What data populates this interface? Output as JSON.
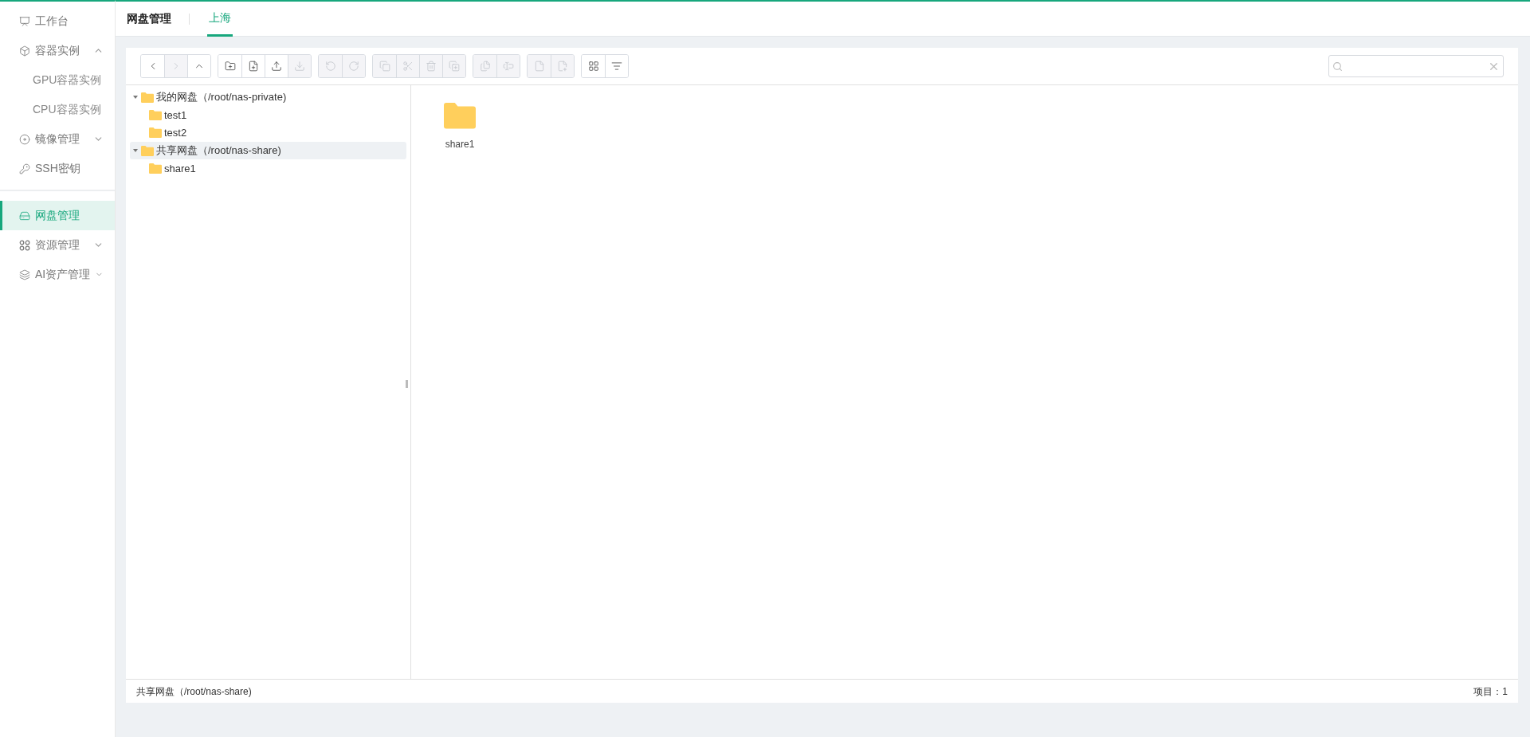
{
  "sidebar": {
    "sections": [
      {
        "items": [
          {
            "label": "工作台",
            "selected": false
          },
          {
            "label": "容器实例",
            "selected": false,
            "expanded": true,
            "children": [
              {
                "label": "GPU容器实例",
                "selected": false
              },
              {
                "label": "CPU容器实例",
                "selected": false
              }
            ]
          },
          {
            "label": "镜像管理",
            "selected": false,
            "expanded": false
          },
          {
            "label": "SSH密钥",
            "selected": false
          }
        ]
      },
      {
        "items": [
          {
            "label": "网盘管理",
            "selected": true
          },
          {
            "label": "资源管理",
            "selected": false,
            "expanded": false
          },
          {
            "label": "AI资产管理",
            "selected": false,
            "expanded": false
          }
        ]
      }
    ]
  },
  "header": {
    "title": "网盘管理",
    "tabs": [
      {
        "label": "上海",
        "selected": true
      }
    ]
  },
  "toolbar": {
    "groups": [
      [
        {
          "disabled": false
        },
        {
          "disabled": true
        },
        {
          "disabled": false
        }
      ],
      [
        {
          "disabled": false
        },
        {
          "disabled": false
        },
        {
          "disabled": false
        },
        {
          "disabled": true
        }
      ],
      [
        {
          "disabled": true
        },
        {
          "disabled": true
        }
      ],
      [
        {
          "disabled": true
        },
        {
          "disabled": true
        },
        {
          "disabled": true
        },
        {
          "disabled": true
        }
      ],
      [
        {
          "disabled": true
        },
        {
          "disabled": true
        }
      ],
      [
        {
          "disabled": true
        },
        {
          "disabled": true
        }
      ],
      [
        {
          "disabled": false
        },
        {
          "disabled": false
        }
      ]
    ]
  },
  "tree": [
    {
      "label": "我的网盘（/root/nas-private)",
      "expanded": true,
      "selected": false,
      "children": [
        {
          "label": "test1",
          "selected": false
        },
        {
          "label": "test2",
          "selected": false
        }
      ]
    },
    {
      "label": "共享网盘（/root/nas-share)",
      "expanded": true,
      "selected": true,
      "children": [
        {
          "label": "share1",
          "selected": false
        }
      ]
    }
  ],
  "files": [
    {
      "name": "share1"
    }
  ],
  "status_bar": {
    "path": "共享网盘（/root/nas-share)",
    "count": "项目：1"
  }
}
